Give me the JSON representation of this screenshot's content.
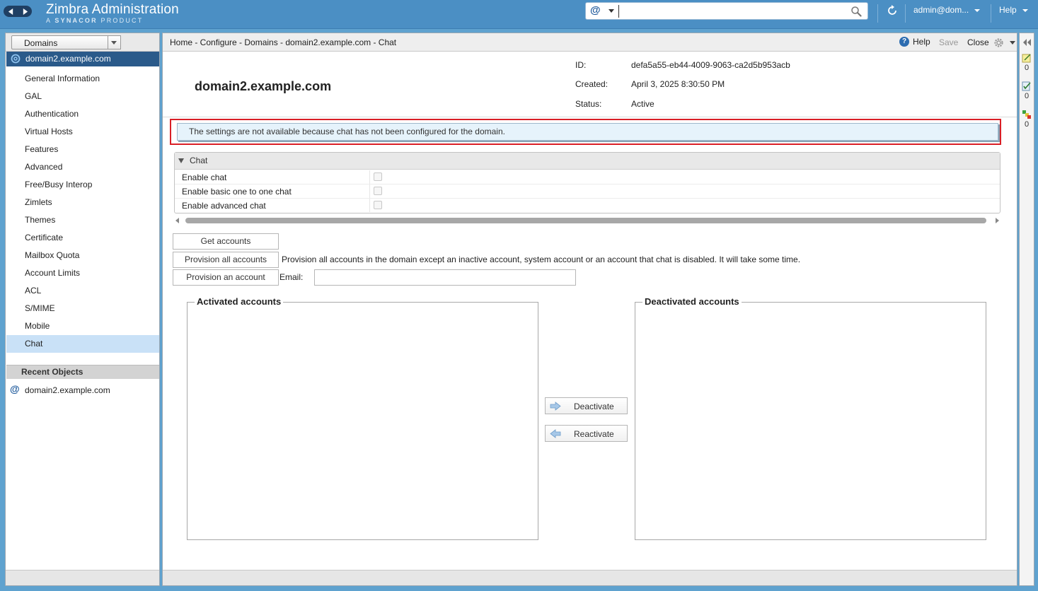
{
  "header": {
    "title": "Zimbra Administration",
    "subtitle_prefix": "A",
    "subtitle_brand": "SYNACOR",
    "subtitle_suffix": "PRODUCT",
    "search_type_symbol": "@",
    "search_value": "",
    "user": "admin@dom...",
    "help": "Help",
    "icons": [
      "back-arrow-icon",
      "forward-arrow-icon",
      "search-icon",
      "refresh-icon"
    ]
  },
  "left_panel": {
    "object_type": "Domains",
    "selected_domain": "domain2.example.com",
    "nav_items": [
      "General Information",
      "GAL",
      "Authentication",
      "Virtual Hosts",
      "Features",
      "Advanced",
      "Free/Busy Interop",
      "Zimlets",
      "Themes",
      "Certificate",
      "Mailbox Quota",
      "Account Limits",
      "ACL",
      "S/MIME",
      "Mobile",
      "Chat"
    ],
    "active_item": "Chat",
    "recent_header": "Recent Objects",
    "recent_items": [
      "domain2.example.com"
    ]
  },
  "toolbar": {
    "breadcrumb": "Home - Configure - Domains - domain2.example.com - Chat",
    "help": "Help",
    "save": "Save",
    "close": "Close"
  },
  "entity": {
    "name": "domain2.example.com",
    "id_label": "ID:",
    "id_value": "defa5a55-eb44-4009-9063-ca2d5b953acb",
    "created_label": "Created:",
    "created_value": "April 3, 2025 8:30:50 PM",
    "status_label": "Status:",
    "status_value": "Active"
  },
  "info_message": "The settings are not available because chat has not been configured for the domain.",
  "chat_section": {
    "title": "Chat",
    "rows": [
      {
        "label": "Enable chat",
        "checked": false
      },
      {
        "label": "Enable basic one to one chat",
        "checked": false
      },
      {
        "label": "Enable advanced chat",
        "checked": false
      }
    ]
  },
  "actions": {
    "get_accounts": "Get accounts",
    "provision_all": "Provision all accounts",
    "provision_all_desc": "Provision all accounts in the domain except an inactive account, system account or an account that chat is disabled. It will take some time.",
    "provision_one": "Provision an account",
    "email_label": "Email:",
    "email_value": ""
  },
  "accounts": {
    "activated_title": "Activated accounts",
    "deactivated_title": "Deactivated accounts",
    "deactivate": "Deactivate",
    "reactivate": "Reactivate"
  },
  "right_rail": {
    "counts": [
      "0",
      "0",
      "0"
    ]
  },
  "colors": {
    "header_bg": "#4b8fc4",
    "selected_tree_bg": "#2a5a8a",
    "active_nav_bg": "#c9e1f7",
    "highlight_border": "#d91f26",
    "info_bg": "#e6f3fb"
  }
}
